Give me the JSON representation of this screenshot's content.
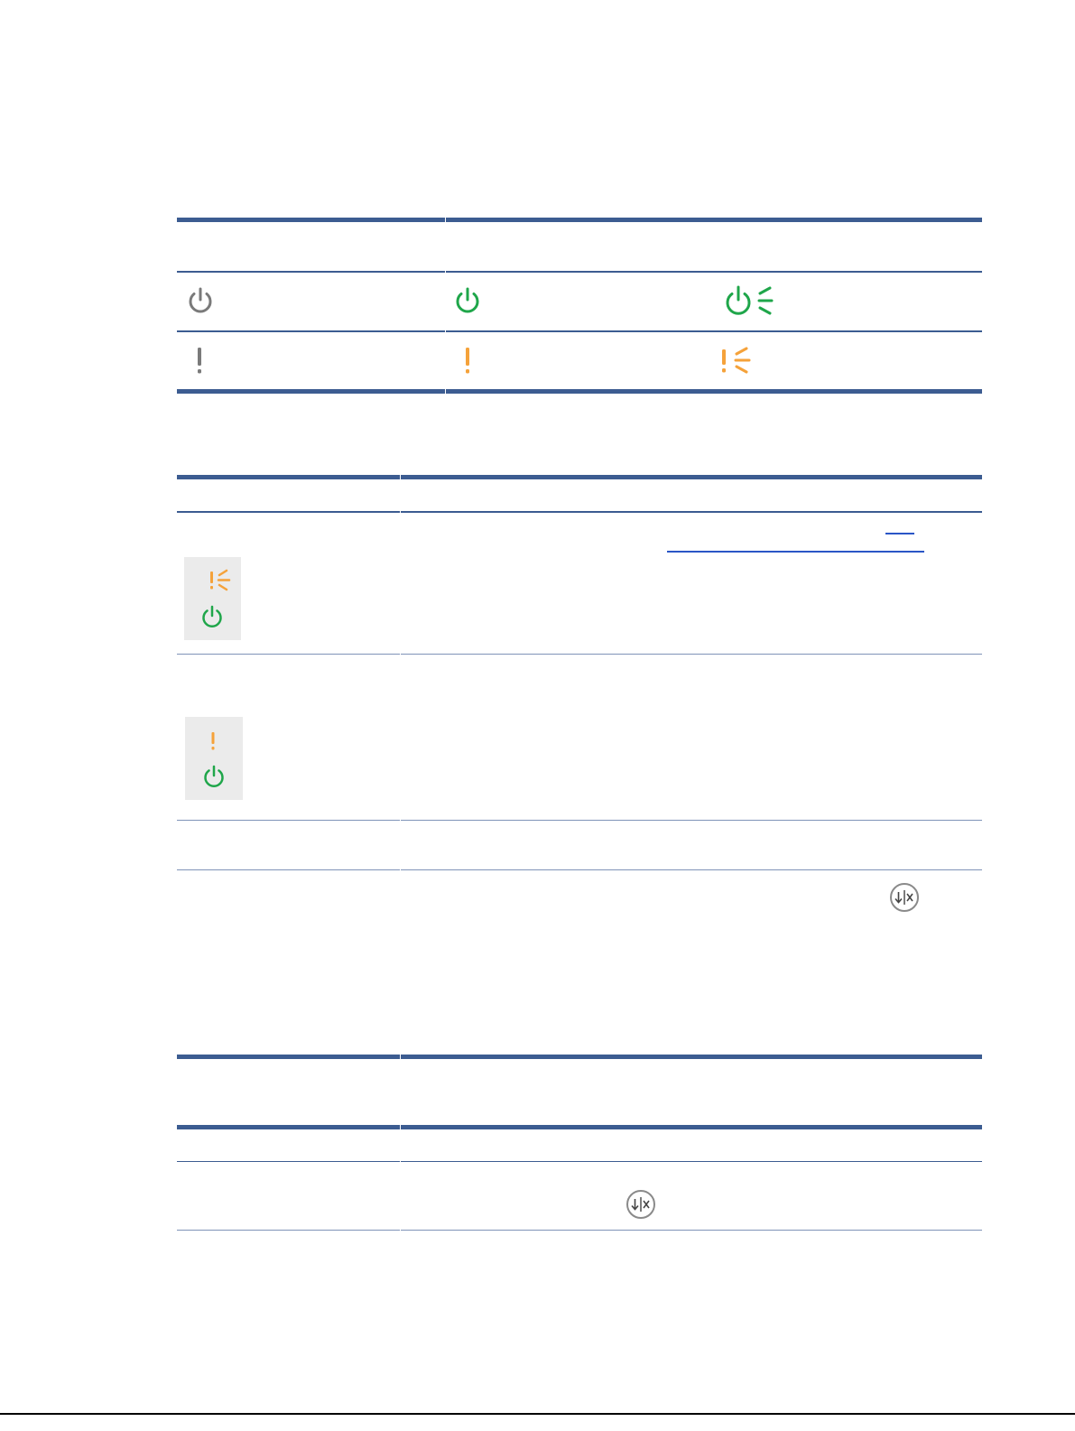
{
  "colors": {
    "rule": "#3c5c91",
    "light_off": "#7a7a7a",
    "power_green": "#1fa64a",
    "warning_orange": "#f5a23a",
    "panel_gray": "#ebebeb",
    "link_blue": "#2a56c6"
  },
  "legend_table": {
    "rows": [
      {
        "off": "power-off-icon",
        "on": "power-on-icon",
        "blinking": "power-blinking-icon"
      },
      {
        "off": "attention-off-icon",
        "on": "attention-on-icon",
        "blinking": "attention-blinking-icon"
      }
    ]
  },
  "status_table": {
    "rows": [
      {
        "panel_icons": [
          "attention-blinking-icon",
          "power-on-icon"
        ],
        "has_link": true
      },
      {
        "panel_icons": [
          "attention-on-icon",
          "power-on-icon"
        ],
        "has_link": false
      },
      {
        "panel_icons": [],
        "has_link": false
      },
      {
        "panel_icons": [],
        "inline_icon": "resume-cancel-icon"
      }
    ]
  },
  "action_table": {
    "rows": [
      {
        "inline_icon": "resume-cancel-icon"
      }
    ]
  }
}
